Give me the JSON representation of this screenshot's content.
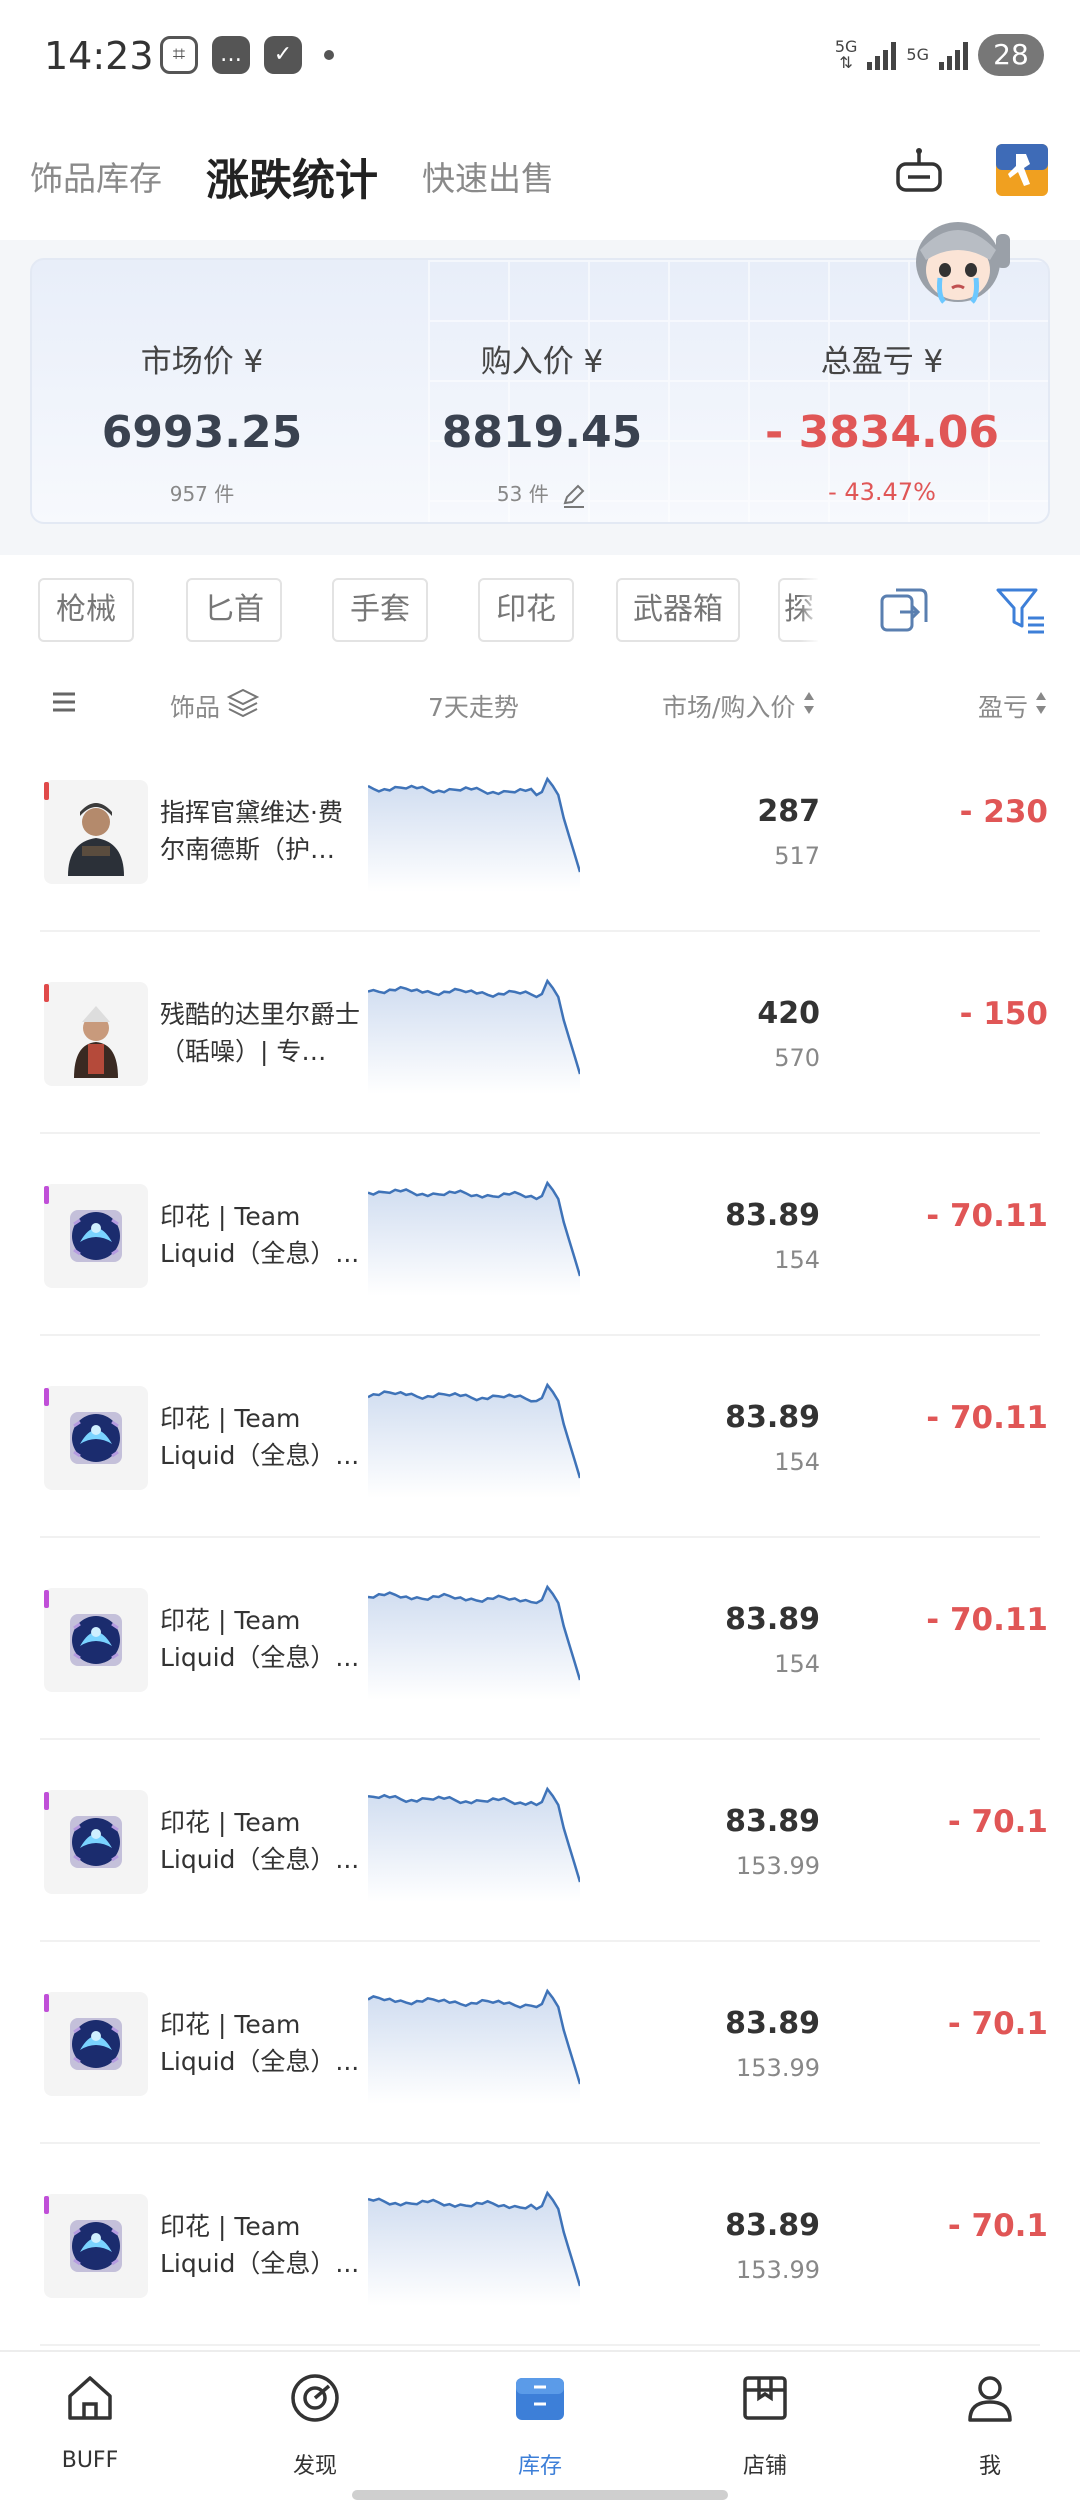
{
  "status_bar": {
    "time": "14:23",
    "net1": "5G",
    "net2": "5G",
    "battery": "28"
  },
  "header": {
    "tabs": [
      {
        "label": "饰品库存",
        "active": false
      },
      {
        "label": "涨跌统计",
        "active": true
      },
      {
        "label": "快速出售",
        "active": false
      }
    ],
    "icons": [
      "bot-icon",
      "csgo-game-icon"
    ]
  },
  "summary": {
    "market": {
      "label": "市场价 ¥",
      "value": "6993.25",
      "sub": "957 件"
    },
    "purchase": {
      "label": "购入价 ¥",
      "value": "8819.45",
      "sub": "53 件"
    },
    "profit": {
      "label": "总盈亏 ¥",
      "value": "- 3834.06",
      "sub": "- 43.47%"
    }
  },
  "filters": [
    "枪械",
    "匕首",
    "手套",
    "印花",
    "武器箱",
    "探"
  ],
  "columns": {
    "item": "饰品",
    "trend": "7天走势",
    "price": "市场/购入价",
    "profit": "盈亏"
  },
  "colors": {
    "accent": "#3d7fd8",
    "negative": "#e05656",
    "rarity_red": "#e04a4a",
    "rarity_purple": "#c04fd8",
    "sparkline": "#3f73b8"
  },
  "items": [
    {
      "name": "指挥官黛维达·费尔南德斯（护…",
      "market": "287",
      "buy": "517",
      "pl": "- 230",
      "rarity": "red",
      "thumb": "agent"
    },
    {
      "name": "残酷的达里尔爵士（聒噪）| 专…",
      "market": "420",
      "buy": "570",
      "pl": "- 150",
      "rarity": "red",
      "thumb": "agent2"
    },
    {
      "name": "印花 | Team Liquid（全息）...",
      "market": "83.89",
      "buy": "154",
      "pl": "- 70.11",
      "rarity": "purple",
      "thumb": "sticker"
    },
    {
      "name": "印花 | Team Liquid（全息）...",
      "market": "83.89",
      "buy": "154",
      "pl": "- 70.11",
      "rarity": "purple",
      "thumb": "sticker"
    },
    {
      "name": "印花 | Team Liquid（全息）...",
      "market": "83.89",
      "buy": "154",
      "pl": "- 70.11",
      "rarity": "purple",
      "thumb": "sticker"
    },
    {
      "name": "印花 | Team Liquid（全息）...",
      "market": "83.89",
      "buy": "153.99",
      "pl": "- 70.1",
      "rarity": "purple",
      "thumb": "sticker"
    },
    {
      "name": "印花 | Team Liquid（全息）...",
      "market": "83.89",
      "buy": "153.99",
      "pl": "- 70.1",
      "rarity": "purple",
      "thumb": "sticker"
    },
    {
      "name": "印花 | Team Liquid（全息）...",
      "market": "83.89",
      "buy": "153.99",
      "pl": "- 70.1",
      "rarity": "purple",
      "thumb": "sticker"
    }
  ],
  "bottom_nav": [
    {
      "label": "BUFF",
      "icon": "home-icon",
      "active": false
    },
    {
      "label": "发现",
      "icon": "compass-icon",
      "active": false
    },
    {
      "label": "库存",
      "icon": "inventory-icon",
      "active": true
    },
    {
      "label": "店铺",
      "icon": "store-icon",
      "active": false
    },
    {
      "label": "我",
      "icon": "profile-icon",
      "active": false
    }
  ]
}
